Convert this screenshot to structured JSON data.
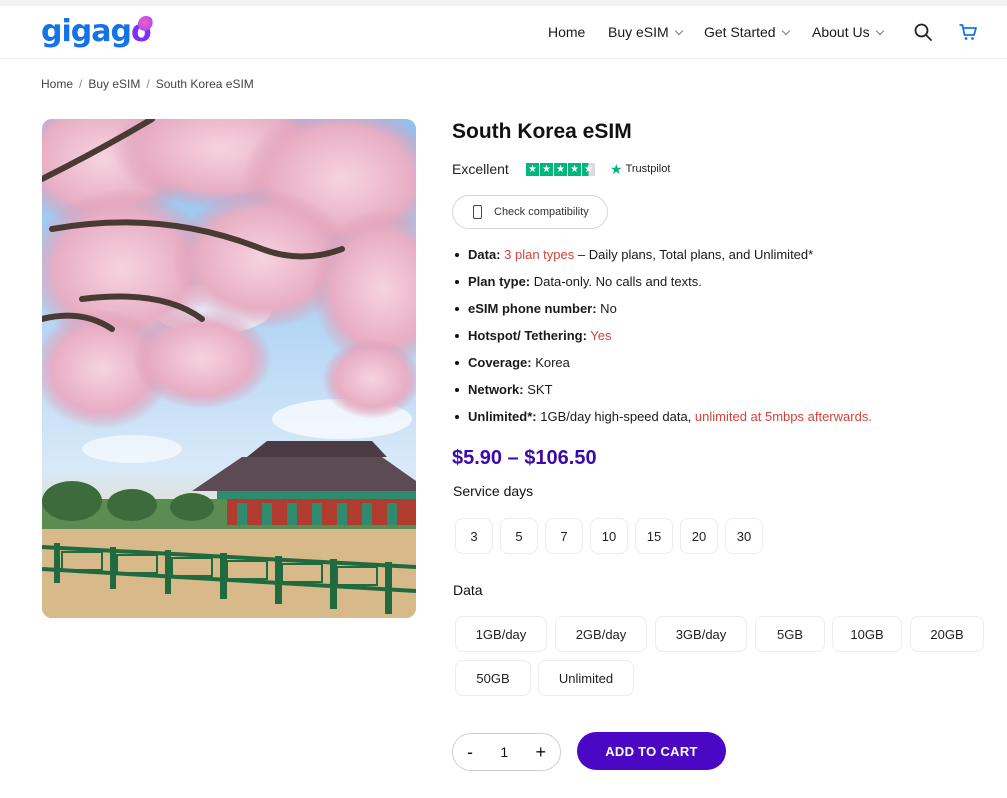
{
  "brand": {
    "logo_text_a": "gigag",
    "logo_text_b": "o"
  },
  "nav": {
    "items": [
      {
        "label": "Home",
        "dropdown": false
      },
      {
        "label": "Buy eSIM",
        "dropdown": true
      },
      {
        "label": "Get Started",
        "dropdown": true
      },
      {
        "label": "About Us",
        "dropdown": true
      }
    ],
    "search_icon": "search-icon",
    "cart_icon": "cart-icon"
  },
  "breadcrumb": [
    "Home",
    "Buy eSIM",
    "South Korea eSIM"
  ],
  "product": {
    "title": "South Korea eSIM",
    "rating_label": "Excellent",
    "rating_stars": 4.5,
    "trustpilot": "Trustpilot",
    "compat_label": "Check compatibility",
    "features": [
      {
        "key": "Data:",
        "red": "3 plan types",
        "rest": " – Daily plans, Total plans, and Unlimited*"
      },
      {
        "key": "Plan type:",
        "rest": " Data-only. No calls and texts."
      },
      {
        "key": "eSIM phone number:",
        "rest": " No"
      },
      {
        "key": "Hotspot/ Tethering:",
        "red": " Yes"
      },
      {
        "key": "Coverage:",
        "rest": " Korea"
      },
      {
        "key": "Network:",
        "rest": " SKT"
      },
      {
        "key": "Unlimited*:",
        "rest": " 1GB/day high-speed data, ",
        "red_after": "unlimited at 5mbps afterwards."
      }
    ],
    "price": "$5.90 – $106.50",
    "service_days_label": "Service days",
    "service_days": [
      "3",
      "5",
      "7",
      "10",
      "15",
      "20",
      "30"
    ],
    "data_label": "Data",
    "data_options": [
      "1GB/day",
      "2GB/day",
      "3GB/day",
      "5GB",
      "10GB",
      "20GB",
      "50GB",
      "Unlimited"
    ],
    "qty_minus": "-",
    "qty_value": "1",
    "qty_plus": "+",
    "add_to_cart": "ADD TO CART"
  },
  "colors": {
    "brand_blue": "#1473e6",
    "accent_purple": "#4a07c4",
    "price_purple": "#3b0aa8",
    "highlight_red": "#d6423a",
    "trustpilot_green": "#00b67a"
  }
}
